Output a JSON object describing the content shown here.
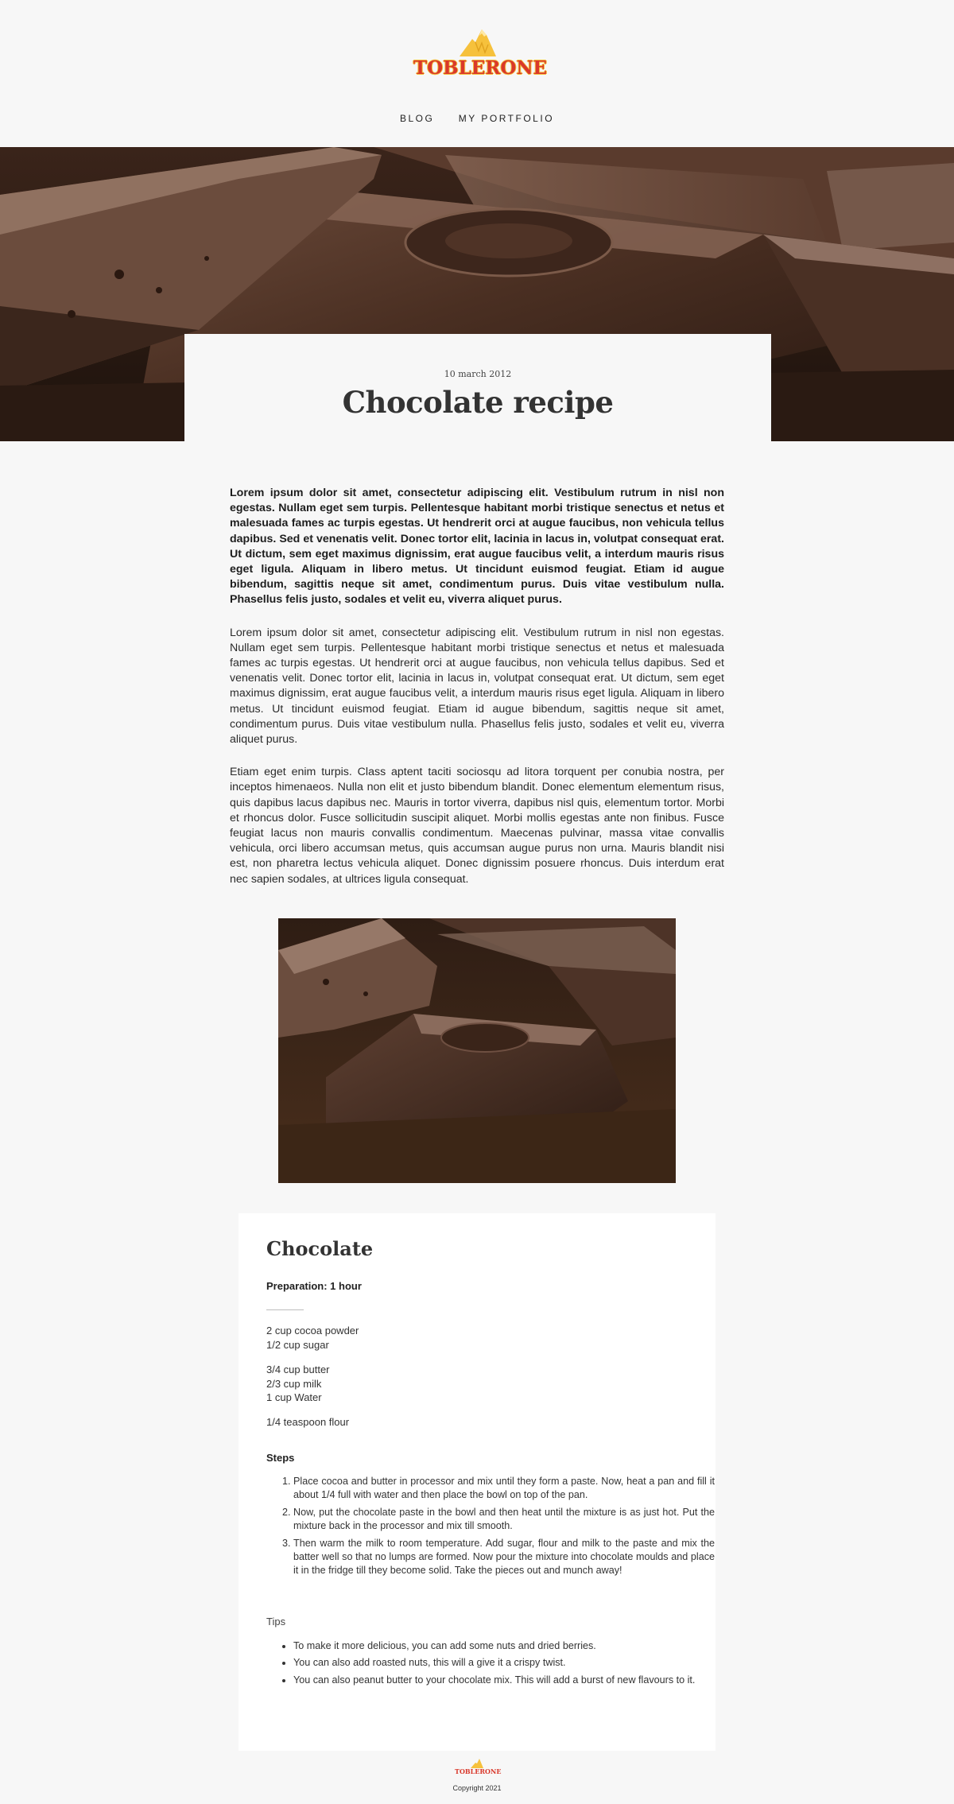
{
  "brand": {
    "name": "TOBLERONE",
    "primary_color": "#d9382b",
    "accent_color": "#f6c13c",
    "icon": "mountain-logo-icon"
  },
  "nav": {
    "items": [
      {
        "label": "BLOG"
      },
      {
        "label": "MY PORTFOLIO"
      }
    ]
  },
  "hero": {
    "image": "chocolate-bars-photo",
    "date": "10 march 2012",
    "title": "Chocolate recipe"
  },
  "article": {
    "paragraphs": [
      "Lorem ipsum dolor sit amet, consectetur adipiscing elit. Vestibulum rutrum in nisl non egestas. Nullam eget sem turpis. Pellentesque habitant morbi tristique senectus et netus et malesuada fames ac turpis egestas. Ut hendrerit orci at augue faucibus, non vehicula tellus dapibus. Sed et venenatis velit. Donec tortor elit, lacinia in lacus in, volutpat consequat erat. Ut dictum, sem eget maximus dignissim, erat augue faucibus velit, a interdum mauris risus eget ligula. Aliquam in libero metus. Ut tincidunt euismod feugiat. Etiam id augue bibendum, sagittis neque sit amet, condimentum purus. Duis vitae vestibulum nulla. Phasellus felis justo, sodales et velit eu, viverra aliquet purus.",
      "Lorem ipsum dolor sit amet, consectetur adipiscing elit. Vestibulum rutrum in nisl non egestas. Nullam eget sem turpis. Pellentesque habitant morbi tristique senectus et netus et malesuada fames ac turpis egestas. Ut hendrerit orci at augue faucibus, non vehicula tellus dapibus. Sed et venenatis velit. Donec tortor elit, lacinia in lacus in, volutpat consequat erat. Ut dictum, sem eget maximus dignissim, erat augue faucibus velit, a interdum mauris risus eget ligula. Aliquam in libero metus. Ut tincidunt euismod feugiat. Etiam id augue bibendum, sagittis neque sit amet, condimentum purus. Duis vitae vestibulum nulla. Phasellus felis justo, sodales et velit eu, viverra aliquet purus.",
      "Etiam eget enim turpis. Class aptent taciti sociosqu ad litora torquent per conubia nostra, per inceptos himenaeos. Nulla non elit et justo bibendum blandit. Donec elementum elementum risus, quis dapibus lacus dapibus nec. Mauris in tortor viverra, dapibus nisl quis, elementum tortor. Morbi et rhoncus dolor. Fusce sollicitudin suscipit aliquet. Morbi mollis egestas ante non finibus. Fusce feugiat lacus non mauris convallis condimentum. Maecenas pulvinar, massa vitae convallis vehicula, orci libero accumsan metus, quis accumsan augue purus non urna. Mauris blandit nisi est, non pharetra lectus vehicula aliquet. Donec dignissim posuere rhoncus. Duis interdum erat nec sapien sodales, at ultrices ligula consequat."
    ]
  },
  "recipe": {
    "title": "Chocolate",
    "prep": "Preparation: 1 hour",
    "ingredient_groups": [
      [
        "2 cup cocoa powder",
        "1/2 cup sugar"
      ],
      [
        "3/4 cup butter",
        "2/3 cup milk",
        "1 cup Water"
      ],
      [
        "1/4 teaspoon flour"
      ]
    ],
    "steps_title": "Steps",
    "steps": [
      "Place cocoa and butter in processor and mix until they form a paste. Now, heat a pan and fill it about 1/4 full with water and then place the bowl on top of the pan.",
      "Now, put the chocolate paste in the bowl and then heat until the mixture is as just hot. Put the mixture back in the processor and mix till smooth.",
      "Then warm the milk to room temperature. Add sugar, flour and milk to the paste and mix the batter well so that no lumps are formed. Now pour the mixture into chocolate moulds and place it in the fridge till they become solid. Take the pieces out and munch away!"
    ],
    "tips_title": "Tips",
    "tips": [
      "To make it more delicious, you can add some nuts and dried berries.",
      "You can also add roasted nuts, this will a give it a crispy twist.",
      "You can also peanut butter to your chocolate mix. This will add a burst of new flavours to it."
    ]
  },
  "footer": {
    "brand": "TOBLERONE",
    "copyright": "Copyright 2021"
  }
}
